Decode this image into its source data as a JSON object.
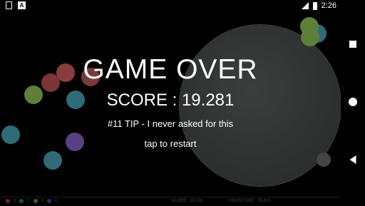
{
  "status_bar": {
    "time": "2:26",
    "icons": [
      "sim-card-icon",
      "a-icon",
      "signal-icon",
      "battery-icon"
    ]
  },
  "overlay": {
    "title": "GAME OVER",
    "score_text": "SCORE : 19.281",
    "tip": "#11 TIP - I never asked for this",
    "restart": "tap to restart"
  },
  "hud": {
    "counts": [
      {
        "color": "#6b2626",
        "value": "0"
      },
      {
        "color": "#1f4a55",
        "value": "1"
      },
      {
        "color": "#3c5a28",
        "value": "0"
      },
      {
        "color": "#3d2a5a",
        "value": "1"
      }
    ],
    "score": "SCORE : 19.116",
    "highscore": "HIGHSCORE : 35.803"
  },
  "colors": {
    "red": "#8a3c3c",
    "teal": "#2e6b77",
    "green": "#5d7f3a",
    "purple": "#5c3f82",
    "big_ball": "#2f3331"
  },
  "navbar": {
    "icons": [
      "recents-square-icon",
      "home-circle-icon",
      "back-triangle-icon"
    ]
  }
}
